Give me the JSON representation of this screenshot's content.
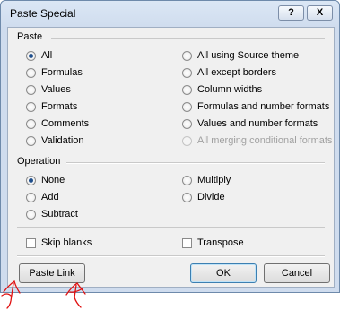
{
  "dialog": {
    "title": "Paste Special",
    "help_label": "?",
    "close_label": "X"
  },
  "paste": {
    "label": "Paste",
    "left": [
      {
        "label": "All",
        "selected": true
      },
      {
        "label": "Formulas",
        "selected": false
      },
      {
        "label": "Values",
        "selected": false
      },
      {
        "label": "Formats",
        "selected": false
      },
      {
        "label": "Comments",
        "selected": false
      },
      {
        "label": "Validation",
        "selected": false
      }
    ],
    "right": [
      {
        "label": "All using Source theme",
        "selected": false,
        "disabled": false
      },
      {
        "label": "All except borders",
        "selected": false,
        "disabled": false
      },
      {
        "label": "Column widths",
        "selected": false,
        "disabled": false
      },
      {
        "label": "Formulas and number formats",
        "selected": false,
        "disabled": false
      },
      {
        "label": "Values and number formats",
        "selected": false,
        "disabled": false
      },
      {
        "label": "All merging conditional formats",
        "selected": false,
        "disabled": true
      }
    ]
  },
  "operation": {
    "label": "Operation",
    "left": [
      {
        "label": "None",
        "selected": true
      },
      {
        "label": "Add",
        "selected": false
      },
      {
        "label": "Subtract",
        "selected": false
      }
    ],
    "right": [
      {
        "label": "Multiply",
        "selected": false
      },
      {
        "label": "Divide",
        "selected": false
      }
    ]
  },
  "options": {
    "skip_blanks": {
      "label": "Skip blanks",
      "checked": false
    },
    "transpose": {
      "label": "Transpose",
      "checked": false
    }
  },
  "buttons": {
    "paste_link": "Paste Link",
    "ok": "OK",
    "cancel": "Cancel"
  },
  "annotation_color": "#e01010"
}
